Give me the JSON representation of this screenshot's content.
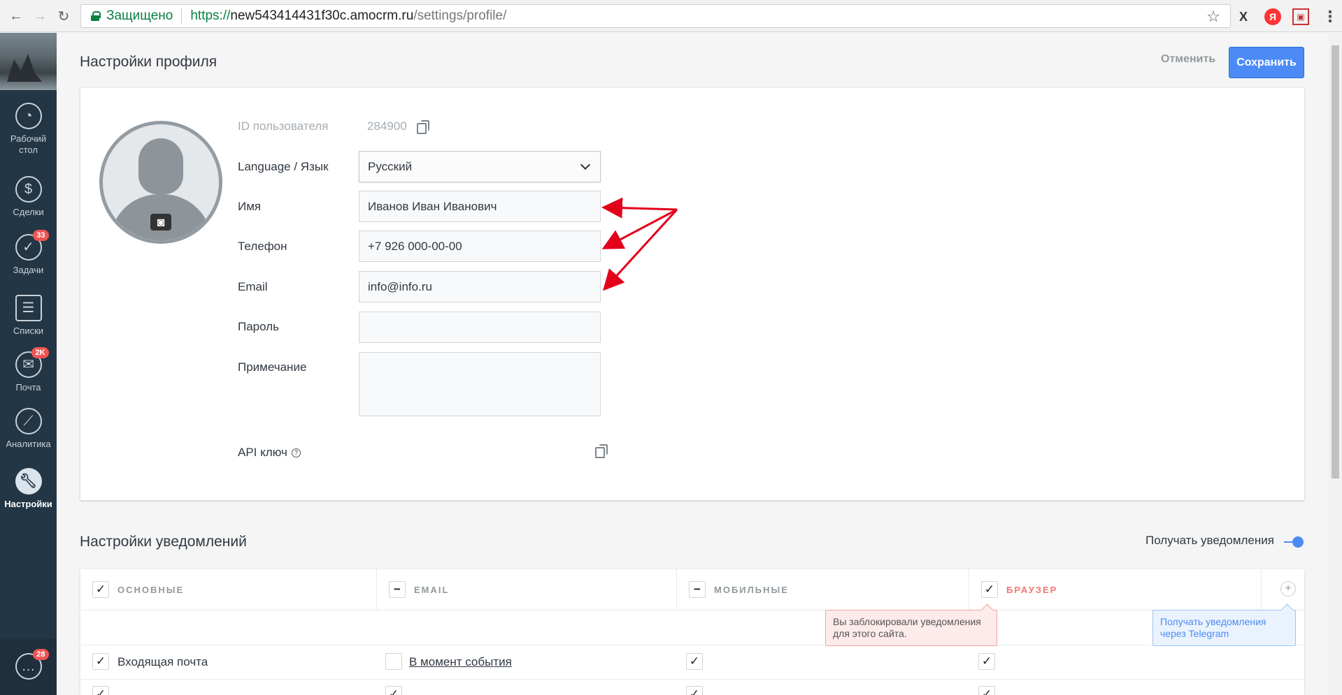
{
  "browser": {
    "secure_label": "Защищено",
    "url_scheme": "https://",
    "url_host": "new543414431f30c.amocrm.ru",
    "url_path": "/settings/profile/",
    "ext_x": "X",
    "ext_ya": "Я"
  },
  "sidebar": {
    "items": [
      {
        "label": "Рабочий стол",
        "icon": "dashboard-icon"
      },
      {
        "label": "Сделки",
        "icon": "dollar-icon"
      },
      {
        "label": "Задачи",
        "icon": "check-icon",
        "badge": "33"
      },
      {
        "label": "Списки",
        "icon": "list-icon"
      },
      {
        "label": "Почта",
        "icon": "mail-icon",
        "badge": "2K"
      },
      {
        "label": "Аналитика",
        "icon": "chart-icon"
      },
      {
        "label": "Настройки",
        "icon": "wrench-icon"
      }
    ],
    "chat_badge": "28"
  },
  "profile": {
    "title": "Настройки профиля",
    "cancel_label": "Отменить",
    "save_label": "Сохранить",
    "user_id_label": "ID пользователя",
    "user_id_value": "284900",
    "language_label": "Language / Язык",
    "language_value": "Русский",
    "name_label": "Имя",
    "name_value": "Иванов Иван Иванович",
    "phone_label": "Телефон",
    "phone_value": "+7 926 000-00-00",
    "email_label": "Email",
    "email_value": "info@info.ru",
    "password_label": "Пароль",
    "password_value": "",
    "note_label": "Примечание",
    "note_value": "",
    "api_label": "API ключ",
    "api_help": "?"
  },
  "notifications": {
    "title": "Настройки уведомлений",
    "toggle_label": "Получать уведомления",
    "columns": [
      {
        "label": "ОСНОВНЫЕ",
        "state": "✓"
      },
      {
        "label": "EMAIL",
        "state": "−"
      },
      {
        "label": "МОБИЛЬНЫЕ",
        "state": "−"
      },
      {
        "label": "БРАУЗЕР",
        "state": "✓"
      }
    ],
    "add_label": "+",
    "blocked_tip": "Вы заблокировали уведомления для этого сайта.",
    "telegram_tip": "Получать уведомления через Telegram",
    "rows": [
      {
        "label": "Входящая почта",
        "email": "В момент события",
        "mobile": "✓",
        "browser": "✓"
      }
    ]
  },
  "colors": {
    "accent": "#4c8bf5",
    "sidebar_bg": "#233645",
    "badge": "#f25454",
    "annotation_arrow": "#e3001b"
  }
}
